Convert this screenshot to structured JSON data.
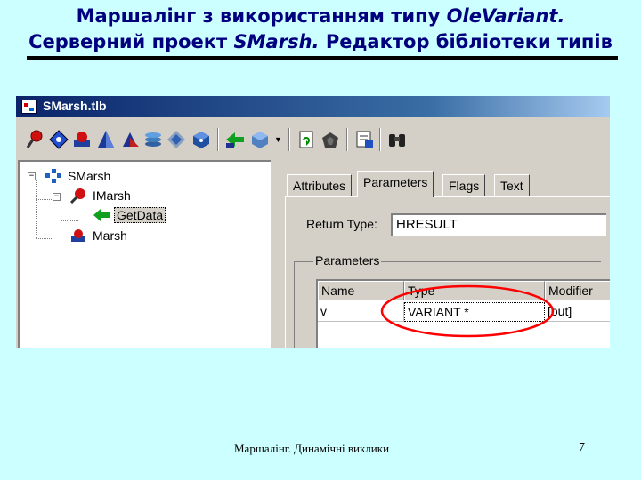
{
  "slide": {
    "title_line1_prefix": "Маршалінг з використанням типу ",
    "title_line1_italic": "OleVariant.",
    "title_line2_prefix": "Серверний проект ",
    "title_line2_italic": "SMarsh.",
    "title_line2_suffix": " Редактор бібліотеки типів",
    "footer": "Маршалінг. Динамічні виклики",
    "page_number": "7"
  },
  "window": {
    "title": "SMarsh.tlb"
  },
  "toolbar": {
    "buttons": [
      {
        "icon": "new-interface-icon"
      },
      {
        "icon": "new-dispinterface-icon"
      },
      {
        "icon": "new-coclass-icon"
      },
      {
        "icon": "new-enum-icon"
      },
      {
        "icon": "new-alias-icon"
      },
      {
        "icon": "new-record-icon"
      },
      {
        "icon": "new-union-icon"
      },
      {
        "icon": "new-module-icon"
      },
      {
        "icon": "new-method-icon"
      },
      {
        "icon": "new-property-icon"
      },
      {
        "icon": "refresh-icon"
      },
      {
        "icon": "register-icon"
      },
      {
        "icon": "export-icon"
      },
      {
        "icon": "binoculars-icon"
      }
    ]
  },
  "tree": {
    "root": "SMarsh",
    "interface": "IMarsh",
    "method": "GetData",
    "coclass": "Marsh"
  },
  "tabs": [
    "Attributes",
    "Parameters",
    "Flags",
    "Text"
  ],
  "active_tab": "Parameters",
  "parameters_tab": {
    "return_type_label": "Return Type:",
    "return_type_value": "HRESULT",
    "group_label": "Parameters",
    "columns": [
      "Name",
      "Type",
      "Modifier"
    ],
    "rows": [
      {
        "name": "v",
        "type": "VARIANT *",
        "modifier": "[out]"
      }
    ]
  },
  "colors": {
    "slide_background": "#ccffff",
    "title_color": "#00007f",
    "highlight_ellipse": "#ff0000"
  }
}
